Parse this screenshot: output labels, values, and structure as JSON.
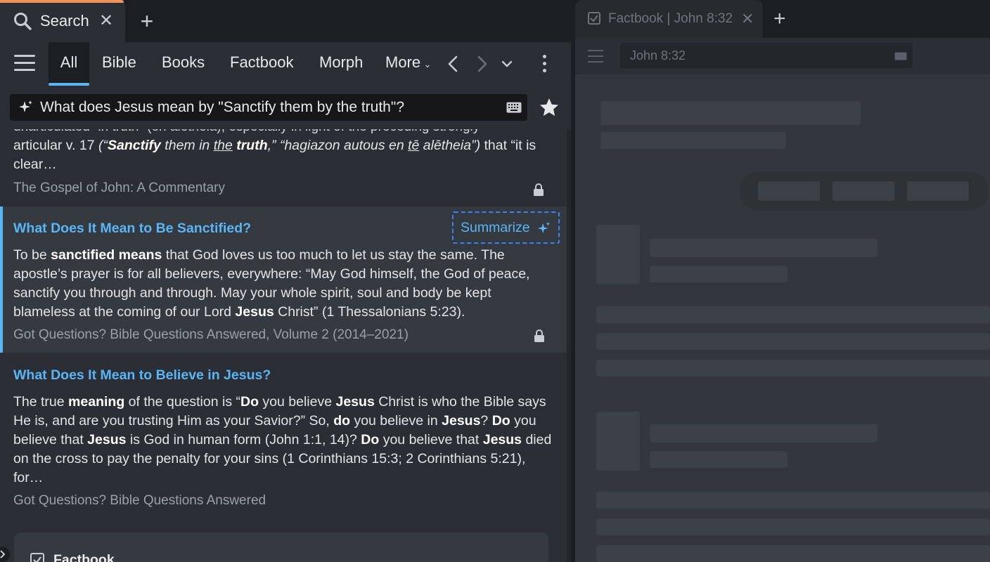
{
  "left_panel": {
    "tab": {
      "label": "Search"
    },
    "nav": {
      "tabs": [
        "All",
        "Bible",
        "Books",
        "Factbook",
        "Morph"
      ],
      "more_label": "More"
    },
    "search": {
      "query": "What does Jesus mean by \"Sanctify them by the truth\"?"
    },
    "results": {
      "partial": {
        "top_line": "unarticulated “in truth” (en alētheia), especially in light of the preceding strongly",
        "source": "The Gospel of John: A Commentary"
      },
      "item1": {
        "title": "What Does It Mean to Be Sanctified?",
        "summarize_label": "Summarize",
        "source": "Got Questions? Bible Questions Answered, Volume 2 (2014–2021)"
      },
      "item2": {
        "title": "What Does It Mean to Believe in Jesus?",
        "source": "Got Questions? Bible Questions Answered"
      },
      "factbook_card": {
        "label": "Factbook"
      }
    }
  },
  "right_panel": {
    "tab": {
      "label": "Factbook | John 8:32"
    },
    "reference": "John 8:32"
  },
  "colors": {
    "accent_link": "#5ab5f5",
    "tab_accent": "#f0925b",
    "focus_outline": "#3b82f6"
  },
  "icons": [
    "search-icon",
    "close-icon",
    "plus-icon",
    "hamburger-icon",
    "chevron-left-icon",
    "chevron-right-icon",
    "chevron-down-icon",
    "kebab-icon",
    "sparkle-icon",
    "keyboard-icon",
    "star-icon",
    "lock-icon",
    "checkbox-icon"
  ]
}
